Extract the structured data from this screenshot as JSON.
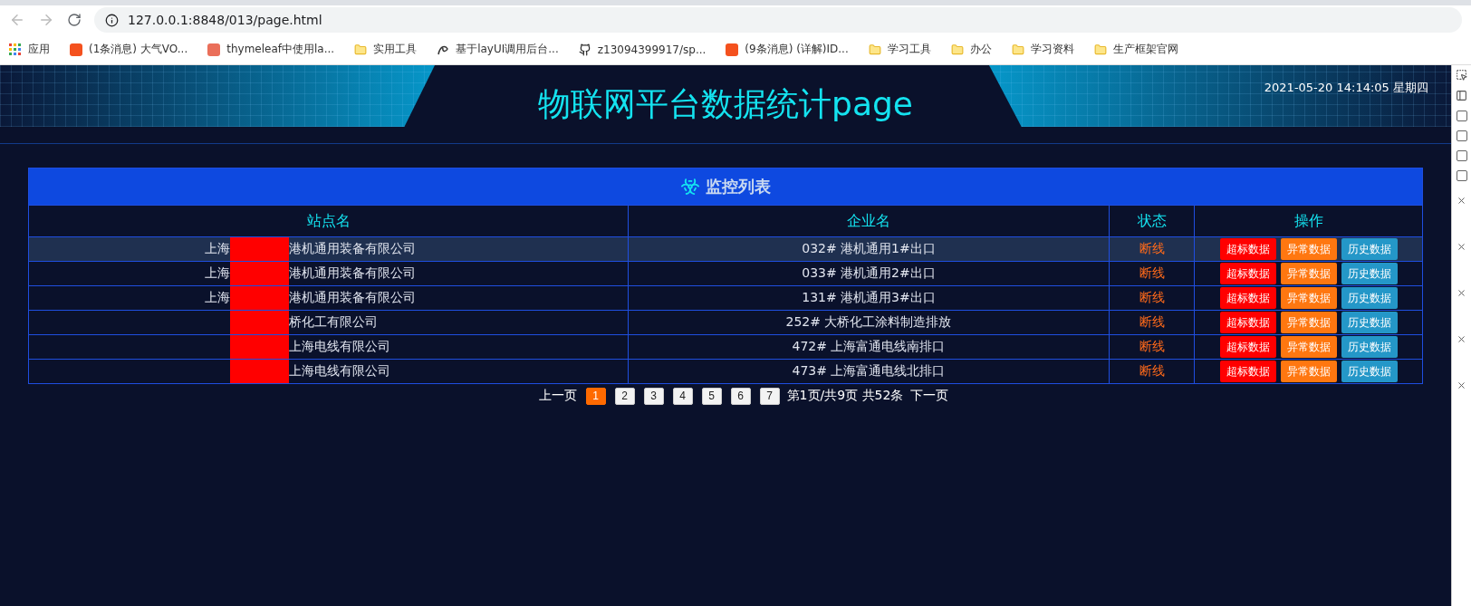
{
  "browser": {
    "address": "127.0.0.1:8848/013/page.html",
    "bookmarks": [
      {
        "label": "应用",
        "kind": "apps"
      },
      {
        "label": "(1条消息) 大气VO...",
        "kind": "csdn"
      },
      {
        "label": "thymeleaf中使用la...",
        "kind": "jian"
      },
      {
        "label": "实用工具",
        "kind": "folder"
      },
      {
        "label": "基于layUI调用后台...",
        "kind": "layui"
      },
      {
        "label": "z13094399917/sp...",
        "kind": "github"
      },
      {
        "label": "(9条消息) (详解)ID...",
        "kind": "csdn"
      },
      {
        "label": "学习工具",
        "kind": "folder"
      },
      {
        "label": "办公",
        "kind": "folder"
      },
      {
        "label": "学习资料",
        "kind": "folder"
      },
      {
        "label": "生产框架官网",
        "kind": "folder"
      }
    ]
  },
  "page": {
    "title": "物联网平台数据统计page",
    "datetime": "2021-05-20 14:14:05 星期四"
  },
  "table": {
    "title": "监控列表",
    "columns": [
      "站点名",
      "企业名",
      "状态",
      "操作"
    ],
    "rows": [
      {
        "site_before": "上海",
        "site_after": "港机通用装备有限公司",
        "redacted": true,
        "enterprise": "032# 港机通用1#出口",
        "status": "断线",
        "selected": true,
        "actions": [
          {
            "label": "超标数据",
            "kind": "over"
          },
          {
            "label": "异常数据",
            "kind": "abnormal"
          },
          {
            "label": "历史数据",
            "kind": "history"
          }
        ]
      },
      {
        "site_before": "上海",
        "site_after": "港机通用装备有限公司",
        "redacted": true,
        "enterprise": "033# 港机通用2#出口",
        "status": "断线",
        "selected": false,
        "actions": [
          {
            "label": "超标数据",
            "kind": "over"
          },
          {
            "label": "异常数据",
            "kind": "abnormal"
          },
          {
            "label": "历史数据",
            "kind": "history"
          }
        ]
      },
      {
        "site_before": "上海",
        "site_after": "港机通用装备有限公司",
        "redacted": true,
        "enterprise": "131# 港机通用3#出口",
        "status": "断线",
        "selected": false,
        "actions": [
          {
            "label": "超标数据",
            "kind": "over"
          },
          {
            "label": "异常数据",
            "kind": "abnormal"
          },
          {
            "label": "历史数据",
            "kind": "history"
          }
        ]
      },
      {
        "site_after": "桥化工有限公司",
        "redacted": true,
        "enterprise": "252# 大桥化工涂料制造排放",
        "status": "断线",
        "selected": false,
        "actions": [
          {
            "label": "超标数据",
            "kind": "over"
          },
          {
            "label": "异常数据",
            "kind": "abnormal"
          },
          {
            "label": "历史数据",
            "kind": "history"
          }
        ]
      },
      {
        "site_after": "上海电线有限公司",
        "redacted": true,
        "enterprise": "472# 上海富通电线南排口",
        "status": "断线",
        "selected": false,
        "actions": [
          {
            "label": "超标数据",
            "kind": "over"
          },
          {
            "label": "异常数据",
            "kind": "abnormal"
          },
          {
            "label": "历史数据",
            "kind": "history"
          }
        ]
      },
      {
        "site_after": "上海电线有限公司",
        "redacted": true,
        "enterprise": "473# 上海富通电线北排口",
        "status": "断线",
        "selected": false,
        "actions": [
          {
            "label": "超标数据",
            "kind": "over"
          },
          {
            "label": "异常数据",
            "kind": "abnormal"
          },
          {
            "label": "历史数据",
            "kind": "history"
          }
        ]
      }
    ]
  },
  "pagination": {
    "prev": "上一页",
    "pages": [
      {
        "label": "1",
        "selected": true
      },
      {
        "label": "2",
        "selected": false
      },
      {
        "label": "3",
        "selected": false
      },
      {
        "label": "4",
        "selected": false
      },
      {
        "label": "5",
        "selected": false
      },
      {
        "label": "6",
        "selected": false
      },
      {
        "label": "7",
        "selected": false
      }
    ],
    "summary": "第1页/共9页 共52条",
    "next": "下一页"
  },
  "devtools": {
    "checkboxes": [
      {
        "checked": false
      },
      {
        "checked": false
      },
      {
        "checked": false
      },
      {
        "checked": false
      }
    ]
  }
}
